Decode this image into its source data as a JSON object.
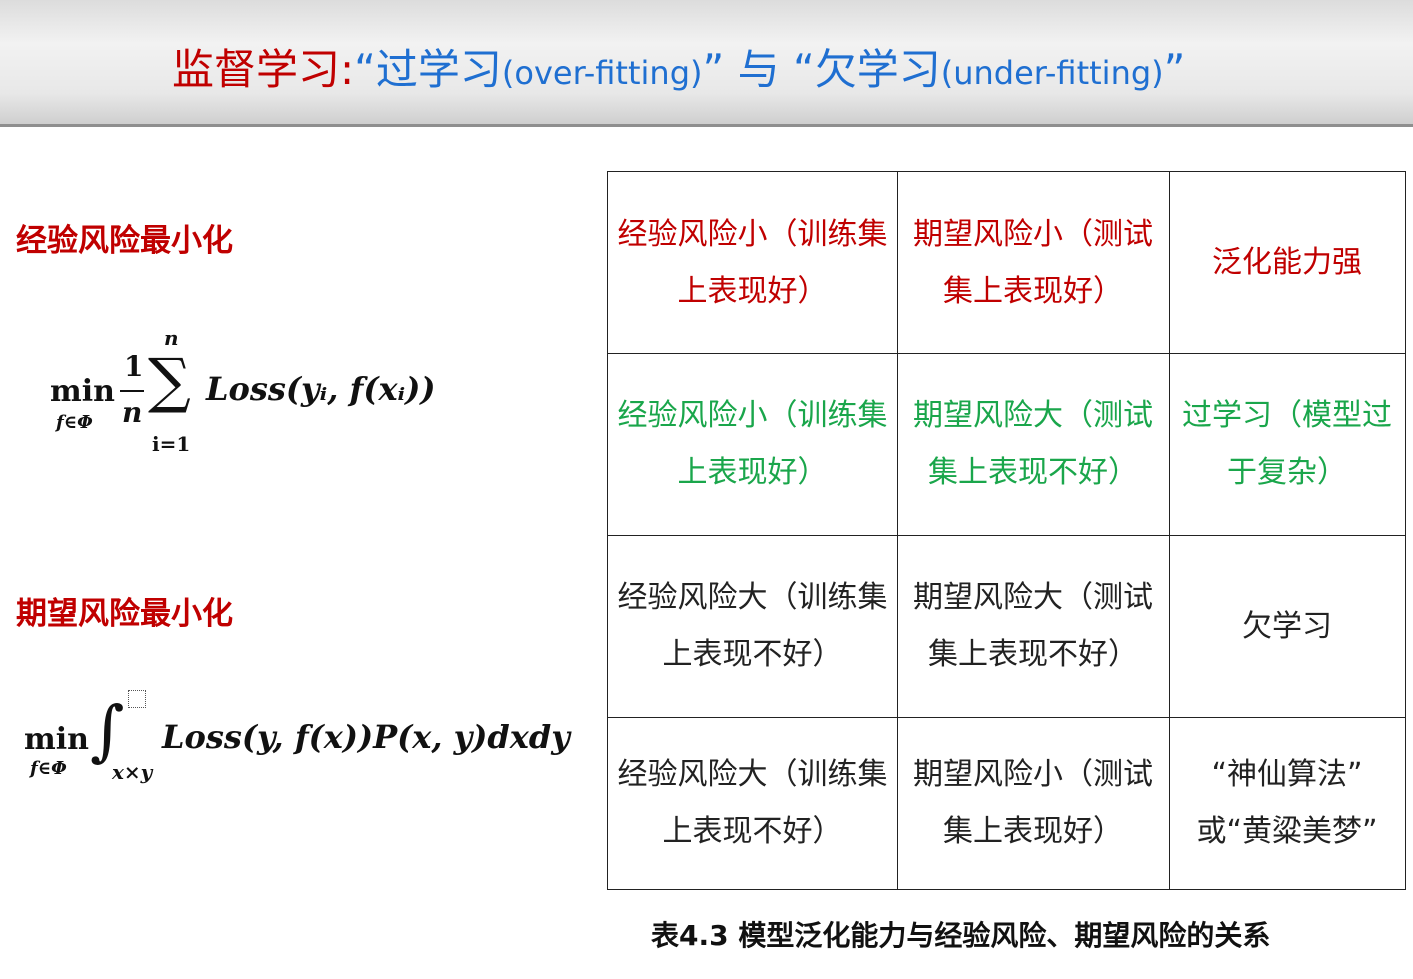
{
  "title": {
    "part1": "监督学习:",
    "part2": "“过学习",
    "part3": "(over-fitting)",
    "part4": "” 与 “欠学习",
    "part5": "(under-fitting)",
    "part6": "”"
  },
  "left": {
    "erm_label": "经验风险最小化",
    "erm_formula": {
      "min": "min",
      "sub": "f∈Φ",
      "numerator": "1",
      "denominator": "n",
      "sigma": "∑",
      "upper": "n",
      "lower": "i=1",
      "expression": "Loss(yᵢ, f(xᵢ))"
    },
    "srm_label": "期望风险最小化",
    "srm_formula": {
      "min": "min",
      "sub": "f∈Φ",
      "integral": "∫",
      "lower": "x×y",
      "expression": "Loss(y, f(x))P(x, y)dxdy"
    }
  },
  "table": {
    "rows": [
      {
        "color": "#c00000",
        "cells": [
          "经验风险小（训练集上表现好）",
          "期望风险小（测试集上表现好）",
          "泛化能力强"
        ]
      },
      {
        "color": "#1aa64b",
        "cells": [
          "经验风险小（训练集上表现好）",
          "期望风险大（测试集上表现不好）",
          "过学习（模型过于复杂）"
        ]
      },
      {
        "color": "#222222",
        "cells": [
          "经验风险大（训练集上表现不好）",
          "期望风险大（测试集上表现不好）",
          "欠学习"
        ]
      },
      {
        "color": "#222222",
        "cells": [
          "经验风险大（训练集上表现不好）",
          "期望风险小（测试集上表现好）",
          "“神仙算法” 或“黄粱美梦”"
        ]
      }
    ]
  },
  "caption": "表4.3  模型泛化能力与经验风险、期望风险的关系"
}
